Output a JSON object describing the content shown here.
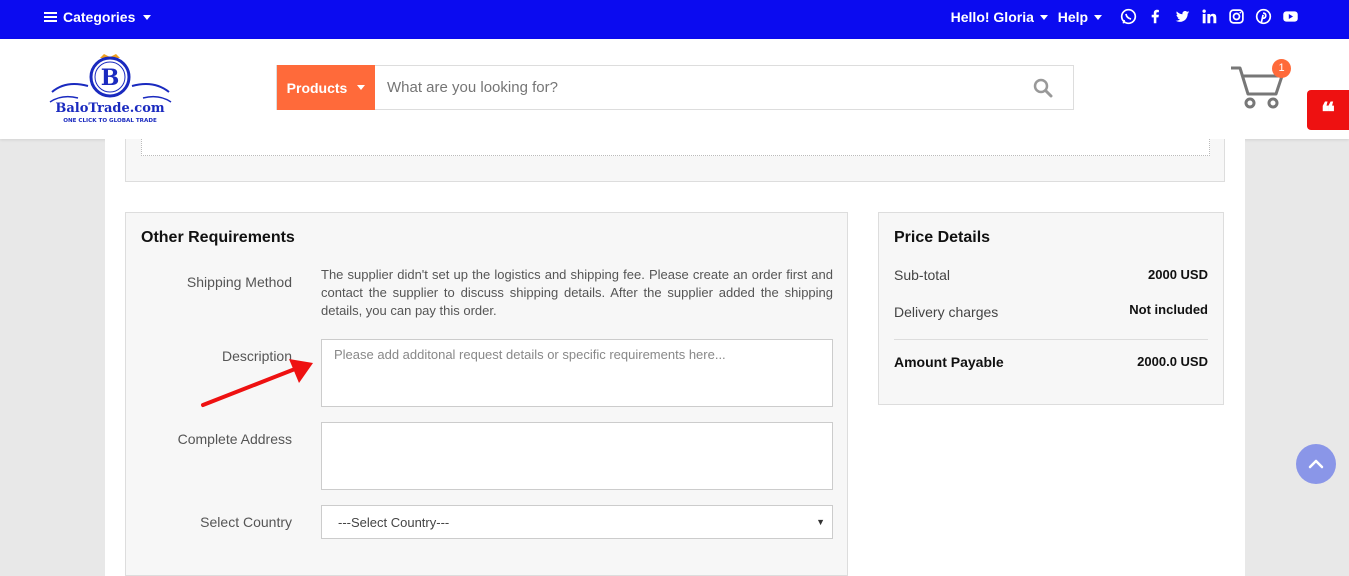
{
  "topbar": {
    "categories_label": "Categories",
    "greeting": "Hello! Gloria",
    "help_label": "Help",
    "social_icons": [
      "whatsapp-icon",
      "facebook-icon",
      "twitter-icon",
      "linkedin-icon",
      "instagram-icon",
      "pinterest-icon",
      "youtube-icon"
    ]
  },
  "header": {
    "logo_text": "BaloTrade.com",
    "logo_letter": "B",
    "logo_tagline": "ONE CLICK TO GLOBAL TRADE",
    "search_category": "Products",
    "search_placeholder": "What are you looking for?",
    "cart_count": "1",
    "quote_icon": "quote-icon"
  },
  "requirements": {
    "title": "Other Requirements",
    "shipping_label": "Shipping Method",
    "shipping_note": "The supplier didn't set up the logistics and shipping fee. Please create an order first and contact the supplier to discuss shipping details. After the supplier added the shipping details, you can pay this order.",
    "description_label": "Description",
    "description_placeholder": "Please add additonal request details or specific requirements here...",
    "address_label": "Complete Address",
    "country_label": "Select Country",
    "country_selected": "---Select Country---"
  },
  "price": {
    "title": "Price Details",
    "subtotal_label": "Sub-total",
    "subtotal_value": "2000 USD",
    "delivery_label": "Delivery charges",
    "delivery_value": "Not included",
    "payable_label": "Amount Payable",
    "payable_value": "2000.0 USD"
  },
  "colors": {
    "topbar": "#0b0bf0",
    "accent": "#ff6a3a",
    "quote": "#ee1111",
    "annotation_arrow": "#ee1111"
  }
}
